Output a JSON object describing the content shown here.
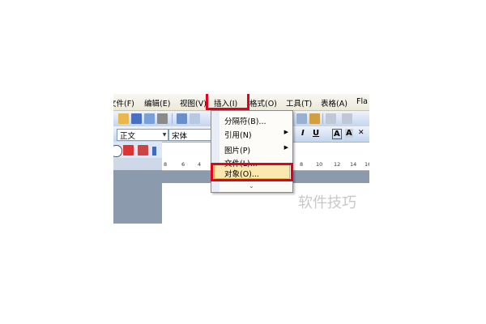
{
  "menubar": {
    "items": [
      {
        "label": "文件(F)"
      },
      {
        "label": "编辑(E)"
      },
      {
        "label": "视图(V)"
      },
      {
        "label": "插入(I)"
      },
      {
        "label": "格式(O)"
      },
      {
        "label": "工具(T)"
      },
      {
        "label": "表格(A)"
      },
      {
        "label": "Fla"
      }
    ]
  },
  "formatting": {
    "style_value": "正文",
    "font_value": "宋体",
    "italic": "I",
    "underline": "U",
    "font_color": "A",
    "char_border": "A"
  },
  "insert_menu": {
    "items": [
      {
        "label": "分隔符(B)..."
      },
      {
        "label": "引用(N)",
        "submenu": true
      },
      {
        "label": "图片(P)",
        "submenu": true
      },
      {
        "label": "文件(L)..."
      },
      {
        "label": "对象(O)..."
      }
    ],
    "expand": "⌄"
  },
  "ruler": {
    "ticks": [
      "8",
      "6",
      "4",
      "8",
      "10",
      "12",
      "14",
      "16"
    ]
  },
  "watermark": "软件技巧",
  "colors": {
    "annotation": "#e3001b",
    "highlight": "#fbe8b0"
  }
}
